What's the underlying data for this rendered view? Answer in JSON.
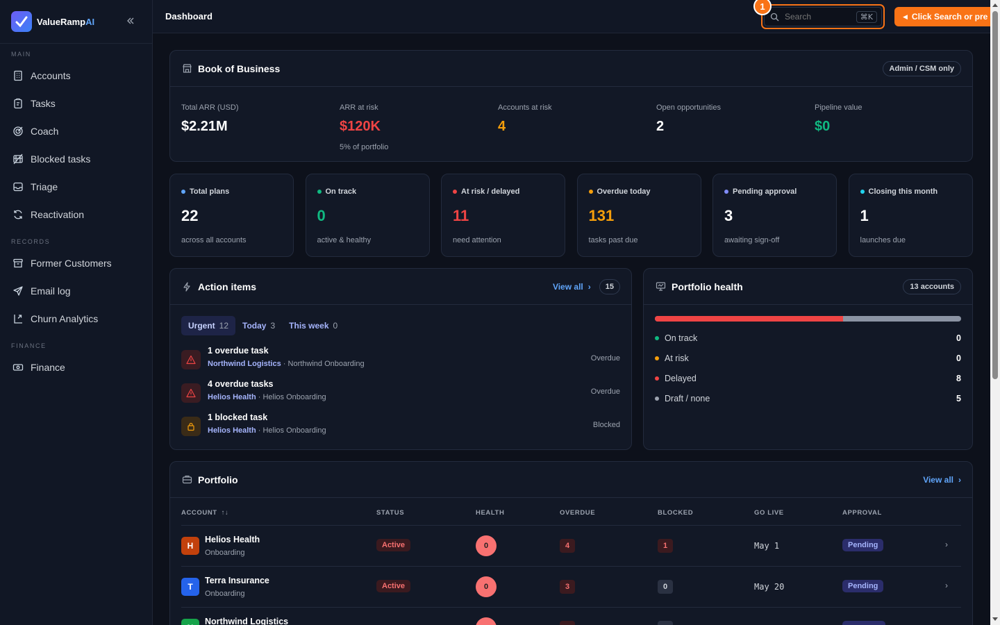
{
  "brand": {
    "name": "ValueRamp",
    "suffix": "AI"
  },
  "sidebar": {
    "sections": [
      {
        "title": "MAIN",
        "items": [
          {
            "label": "Accounts",
            "icon": "building-icon"
          },
          {
            "label": "Tasks",
            "icon": "clipboard-icon"
          },
          {
            "label": "Coach",
            "icon": "target-icon"
          },
          {
            "label": "Blocked tasks",
            "icon": "blocked-icon"
          },
          {
            "label": "Triage",
            "icon": "inbox-icon"
          },
          {
            "label": "Reactivation",
            "icon": "refresh-icon"
          }
        ]
      },
      {
        "title": "RECORDS",
        "items": [
          {
            "label": "Former Customers",
            "icon": "archive-icon"
          },
          {
            "label": "Email log",
            "icon": "send-icon"
          },
          {
            "label": "Churn Analytics",
            "icon": "chart-icon"
          }
        ]
      },
      {
        "title": "FINANCE",
        "items": [
          {
            "label": "Finance",
            "icon": "banknote-icon"
          }
        ]
      }
    ]
  },
  "topbar": {
    "title": "Dashboard",
    "search_placeholder": "Search",
    "shortcut": "⌘K",
    "step_badge": "1",
    "tip": "Click Search or pre"
  },
  "book": {
    "title": "Book of Business",
    "badge": "Admin / CSM only",
    "kpis": [
      {
        "label": "Total ARR (USD)",
        "value": "$2.21M",
        "sub": "",
        "color": "#ffffff"
      },
      {
        "label": "ARR at risk",
        "value": "$120K",
        "sub": "5% of portfolio",
        "color": "#ef4444"
      },
      {
        "label": "Accounts at risk",
        "value": "4",
        "sub": "",
        "color": "#f59e0b"
      },
      {
        "label": "Open opportunities",
        "value": "2",
        "sub": "",
        "color": "#ffffff"
      },
      {
        "label": "Pipeline value",
        "value": "$0",
        "sub": "",
        "color": "#10b981"
      }
    ]
  },
  "stats": [
    {
      "label": "Total plans",
      "value": "22",
      "sub": "across all accounts",
      "dot": "#60a5fa",
      "color": "#ffffff"
    },
    {
      "label": "On track",
      "value": "0",
      "sub": "active & healthy",
      "dot": "#10b981",
      "color": "#10b981"
    },
    {
      "label": "At risk / delayed",
      "value": "11",
      "sub": "need attention",
      "dot": "#ef4444",
      "color": "#ef4444"
    },
    {
      "label": "Overdue today",
      "value": "131",
      "sub": "tasks past due",
      "dot": "#f59e0b",
      "color": "#f59e0b"
    },
    {
      "label": "Pending approval",
      "value": "3",
      "sub": "awaiting sign-off",
      "dot": "#818cf8",
      "color": "#ffffff"
    },
    {
      "label": "Closing this month",
      "value": "1",
      "sub": "launches due",
      "dot": "#22d3ee",
      "color": "#ffffff"
    }
  ],
  "actions": {
    "title": "Action items",
    "view_all": "View all",
    "count": "15",
    "tabs": [
      {
        "label": "Urgent",
        "count": "12"
      },
      {
        "label": "Today",
        "count": "3"
      },
      {
        "label": "This week",
        "count": "0"
      }
    ],
    "items": [
      {
        "title": "1 overdue task",
        "account": "Northwind Logistics",
        "plan": " · Northwind Onboarding",
        "status": "Overdue",
        "kind": "warn"
      },
      {
        "title": "4 overdue tasks",
        "account": "Helios Health",
        "plan": " · Helios Onboarding",
        "status": "Overdue",
        "kind": "warn"
      },
      {
        "title": "1 blocked task",
        "account": "Helios Health",
        "plan": " · Helios Onboarding",
        "status": "Blocked",
        "kind": "lock"
      }
    ]
  },
  "health": {
    "title": "Portfolio health",
    "badge": "13 accounts",
    "bar_fraction": 0.615,
    "legend": [
      {
        "label": "On track",
        "value": "0",
        "color": "#10b981"
      },
      {
        "label": "At risk",
        "value": "0",
        "color": "#f59e0b"
      },
      {
        "label": "Delayed",
        "value": "8",
        "color": "#ef4444"
      },
      {
        "label": "Draft / none",
        "value": "5",
        "color": "#9ca3af"
      }
    ]
  },
  "portfolio": {
    "title": "Portfolio",
    "view_all": "View all",
    "columns": [
      "ACCOUNT",
      "STATUS",
      "HEALTH",
      "OVERDUE",
      "BLOCKED",
      "GO LIVE",
      "APPROVAL"
    ],
    "sort_icon": "↑↓",
    "rows": [
      {
        "initial": "H",
        "name": "Helios Health",
        "stage": "Onboarding",
        "status": "Active",
        "health": "0",
        "overdue": "4",
        "blocked": "1",
        "golive": "May 1",
        "approval": "Pending",
        "color": "#c2410c"
      },
      {
        "initial": "T",
        "name": "Terra Insurance",
        "stage": "Onboarding",
        "status": "Active",
        "health": "0",
        "overdue": "3",
        "blocked": "0",
        "golive": "May 20",
        "approval": "Pending",
        "color": "#2563eb"
      },
      {
        "initial": "N",
        "name": "Northwind Logistics",
        "stage": "",
        "status": "",
        "health": "",
        "overdue": "",
        "blocked": "",
        "golive": "",
        "approval": "",
        "color": "#16a34a"
      }
    ]
  }
}
